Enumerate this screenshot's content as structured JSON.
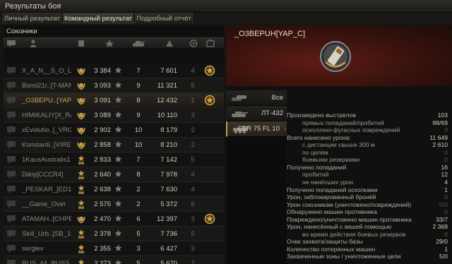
{
  "window": {
    "title": "Результаты боя"
  },
  "tabs": [
    "Личный результат",
    "Командный результат",
    "Подробный отчёт"
  ],
  "team_panel": {
    "title": "Союзники",
    "column_icons": [
      "chat-icon",
      "player-icon",
      "badge-icon",
      "rank-star-icon",
      "kills-tank-icon",
      "damage-icon",
      "frags-icon",
      "achievements-icon"
    ],
    "rows": [
      {
        "name": "X_A_N__S_O_L_O",
        "rank": "3 384",
        "kills": "7",
        "damage": "7 601",
        "frags": "4",
        "ach": true,
        "self": false,
        "badge": "laurel"
      },
      {
        "name": "Bond21r..[T-MAN]",
        "rank": "3 093",
        "kills": "9",
        "damage": "11 321",
        "frags": "5",
        "ach": false,
        "self": false,
        "badge": "laurel"
      },
      {
        "name": "_O3BEPU..[YAP_C]",
        "rank": "3 091",
        "kills": "8",
        "damage": "12 432",
        "frags": "1",
        "ach": true,
        "self": true,
        "badge": "laurel"
      },
      {
        "name": "HIMIKALIY[X_RAY]",
        "rank": "3 089",
        "kills": "9",
        "damage": "10 110",
        "frags": "3",
        "ach": false,
        "self": false,
        "badge": "laurel"
      },
      {
        "name": "xEvolutio..[_VRG_]",
        "rank": "2 902",
        "kills": "10",
        "damage": "8 179",
        "frags": "2",
        "ach": false,
        "self": false,
        "badge": "laurel"
      },
      {
        "name": "Konstanti..[VIREM]",
        "rank": "2 858",
        "kills": "10",
        "damage": "8 210",
        "frags": "2",
        "ach": false,
        "self": false,
        "badge": "laurel"
      },
      {
        "name": "1KausAustralis1",
        "rank": "2 833",
        "kills": "7",
        "damage": "7 142",
        "frags": "5",
        "ach": false,
        "self": false,
        "badge": "chevron"
      },
      {
        "name": "Dikiy[CCCR4]",
        "rank": "2 640",
        "kills": "8",
        "damage": "7 978",
        "frags": "4",
        "ach": false,
        "self": false,
        "badge": "chevron"
      },
      {
        "name": "_PESKAR_[ED1NY]",
        "rank": "2 638",
        "kills": "2",
        "damage": "7 630",
        "frags": "4",
        "ach": false,
        "self": false,
        "badge": "chevron"
      },
      {
        "name": "__Game_Over",
        "rank": "2 575",
        "kills": "2",
        "damage": "5 372",
        "frags": "5",
        "ach": false,
        "self": false,
        "badge": "chevron"
      },
      {
        "name": "ATAMAH..[CHPBY]",
        "rank": "2 470",
        "kills": "6",
        "damage": "12 397",
        "frags": "3",
        "ach": true,
        "self": false,
        "badge": "laurel"
      },
      {
        "name": "Skill_Urb..[SB_15]",
        "rank": "2 378",
        "kills": "5",
        "damage": "7 736",
        "frags": "5",
        "ach": false,
        "self": false,
        "badge": "chevron"
      },
      {
        "name": "serglev",
        "rank": "2 355",
        "kills": "3",
        "damage": "6 427",
        "frags": "3",
        "ach": false,
        "self": false,
        "badge": "chevron"
      },
      {
        "name": "RUS_44_RUSS",
        "rank": "2 273",
        "kills": "5",
        "damage": "5 670",
        "frags": "2",
        "ach": false,
        "self": false,
        "badge": "chevron"
      }
    ]
  },
  "player": {
    "name": "_O3BEPUH[YAP_C]"
  },
  "vehicles": [
    {
      "label": "Все",
      "icon": "all-vehicles-icon"
    },
    {
      "label": "ЛТ-432",
      "icon": "tank-icon"
    },
    {
      "label": "EBR 75 FL 10",
      "icon": "wheeled-vehicle-icon"
    }
  ],
  "stats": [
    {
      "label": "Произведено выстрелов",
      "value": "103",
      "sub": false,
      "dim": false
    },
    {
      "label": "прямых попаданий/пробитий",
      "value": "88/69",
      "sub": true,
      "dim": false
    },
    {
      "label": "осколочно-фугасных повреждений",
      "value": "0",
      "sub": true,
      "dim": true
    },
    {
      "label": "Всего нанесено урона:",
      "value": "11 649",
      "sub": false,
      "dim": false
    },
    {
      "label": "с дистанции свыше 300 м",
      "value": "2 610",
      "sub": true,
      "dim": false
    },
    {
      "label": "по целям",
      "value": "0",
      "sub": true,
      "dim": true
    },
    {
      "label": "боевыми резервами",
      "value": "0",
      "sub": true,
      "dim": true
    },
    {
      "label": "Получено попаданий",
      "value": "16",
      "sub": false,
      "dim": false
    },
    {
      "label": "пробитий",
      "value": "12",
      "sub": true,
      "dim": false
    },
    {
      "label": "не нанёсших урон",
      "value": "4",
      "sub": true,
      "dim": false
    },
    {
      "label": "Получено попаданий осколками",
      "value": "1",
      "sub": false,
      "dim": false
    },
    {
      "label": "Урон, заблокированный бронёй",
      "value": "0",
      "sub": false,
      "dim": true
    },
    {
      "label": "Урон союзникам (уничтожено/повреждений)",
      "value": "0/0",
      "sub": false,
      "dim": true
    },
    {
      "label": "Обнаружено машин противника",
      "value": "0",
      "sub": false,
      "dim": true
    },
    {
      "label": "Повреждено/уничтожено машин противника",
      "value": "33/7",
      "sub": false,
      "dim": false
    },
    {
      "label": "Урон, нанесённый с вашей помощью",
      "value": "2 368",
      "sub": false,
      "dim": false
    },
    {
      "label": "во время действия боевых резервов",
      "value": "0",
      "sub": true,
      "dim": true
    },
    {
      "label": "Очки захвата/защиты базы",
      "value": "29/0",
      "sub": false,
      "dim": false
    },
    {
      "label": "Количество потерянных машин",
      "value": "1",
      "sub": false,
      "dim": false
    },
    {
      "label": "Захваченные зоны / уничтоженные цели",
      "value": "5/0",
      "sub": false,
      "dim": false
    }
  ]
}
